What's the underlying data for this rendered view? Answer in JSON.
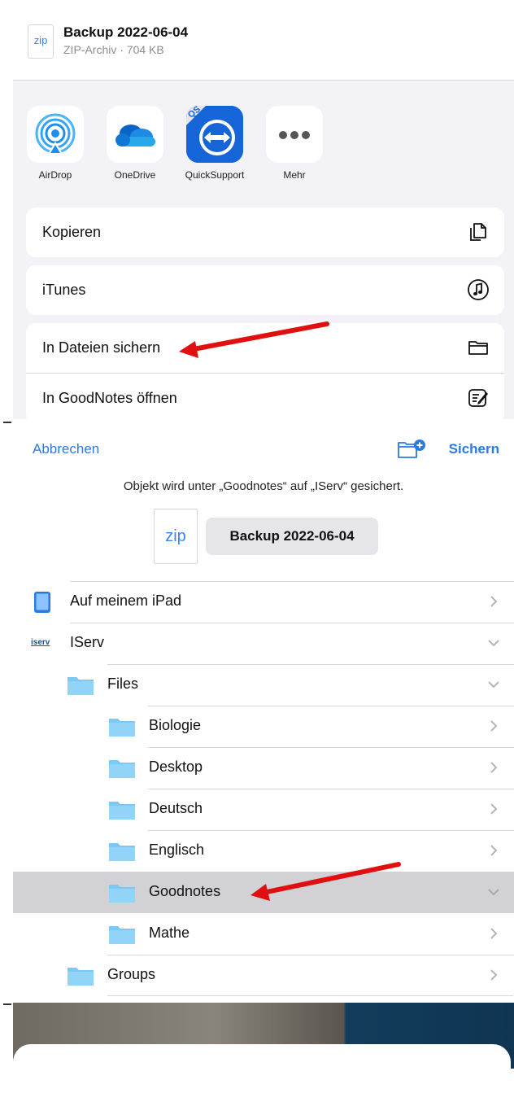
{
  "share_sheet": {
    "file": {
      "thumb_label": "zip",
      "title": "Backup 2022-06-04",
      "subtitle": "ZIP-Archiv · 704 KB"
    },
    "apps": [
      {
        "label": "AirDrop",
        "icon": "airdrop-icon"
      },
      {
        "label": "OneDrive",
        "icon": "onedrive-cloud-icon"
      },
      {
        "label": "QuickSupport",
        "icon": "teamviewer-quicksupport-icon",
        "badge": "QS"
      },
      {
        "label": "Mehr",
        "icon": "more-dots-icon"
      }
    ],
    "actions": [
      {
        "label": "Kopieren",
        "icon": "copy-documents-icon"
      },
      {
        "label": "iTunes",
        "icon": "music-note-icon"
      },
      {
        "label": "In Dateien sichern",
        "icon": "folder-icon"
      },
      {
        "label": "In GoodNotes öffnen",
        "icon": "goodnotes-icon"
      }
    ]
  },
  "save_dialog": {
    "cancel_label": "Abbrechen",
    "save_label": "Sichern",
    "new_folder_icon": "new-folder-icon",
    "info_text": "Objekt wird unter „Goodnotes“ auf „IServ“ gesichert.",
    "file": {
      "thumb_label": "zip",
      "name": "Backup 2022-06-04"
    },
    "locations": [
      {
        "label": "Auf meinem iPad",
        "icon": "ipad-icon",
        "chevron": "right"
      },
      {
        "label": "IServ",
        "icon": "iserv-logo",
        "logo_text": "iserv",
        "chevron": "down"
      },
      {
        "label": "Files",
        "icon": "folder-icon",
        "chevron": "down"
      },
      {
        "label": "Biologie",
        "icon": "folder-icon",
        "chevron": "right"
      },
      {
        "label": "Desktop",
        "icon": "folder-icon",
        "chevron": "right"
      },
      {
        "label": "Deutsch",
        "icon": "folder-icon",
        "chevron": "right"
      },
      {
        "label": "Englisch",
        "icon": "folder-icon",
        "chevron": "right"
      },
      {
        "label": "Goodnotes",
        "icon": "folder-icon",
        "chevron": "down",
        "selected": true
      },
      {
        "label": "Mathe",
        "icon": "folder-icon",
        "chevron": "right"
      },
      {
        "label": "Groups",
        "icon": "folder-icon",
        "chevron": "right"
      }
    ]
  },
  "colors": {
    "accent_blue": "#2a7ae2",
    "folder_blue": "#7cc7f4",
    "annotation_red": "#e01010",
    "sheet_background": "#f2f2f7",
    "selected_row": "#d1d1d6"
  }
}
